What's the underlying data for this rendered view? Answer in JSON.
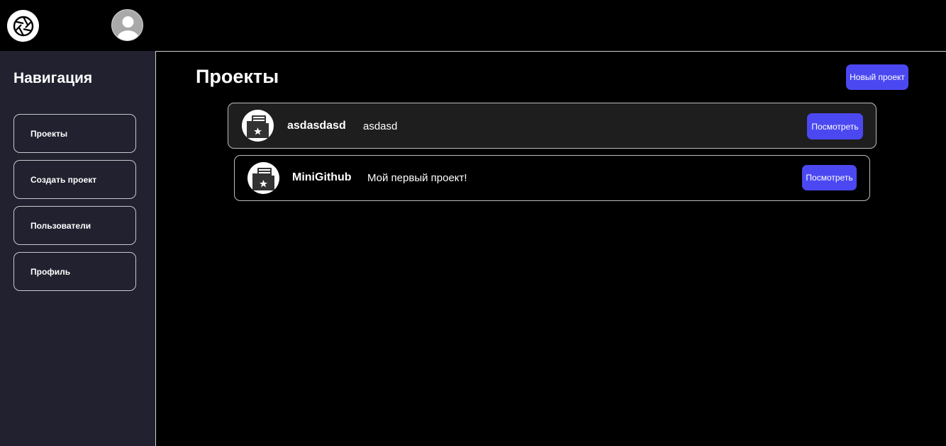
{
  "header": {
    "logo_icon": "aperture-logo-icon",
    "avatar_icon": "user-avatar-icon"
  },
  "sidebar": {
    "title": "Навигация",
    "items": [
      {
        "label": "Проекты"
      },
      {
        "label": "Создать проект"
      },
      {
        "label": "Пользователи"
      },
      {
        "label": "Профиль"
      }
    ]
  },
  "main": {
    "title": "Проекты",
    "new_project_label": "Новый проект",
    "projects": [
      {
        "name": "asdasdasd",
        "description": "asdasd",
        "view_label": "Посмотреть",
        "icon": "folder-star-icon"
      },
      {
        "name": "MiniGithub",
        "description": "Мой первый проект!",
        "view_label": "Посмотреть",
        "icon": "folder-star-icon"
      }
    ]
  },
  "colors": {
    "background": "#000000",
    "sidebar": "#21212f",
    "accent": "#4b48f2",
    "card_hover": "#1e1e1e",
    "border": "#bdbdbd"
  }
}
